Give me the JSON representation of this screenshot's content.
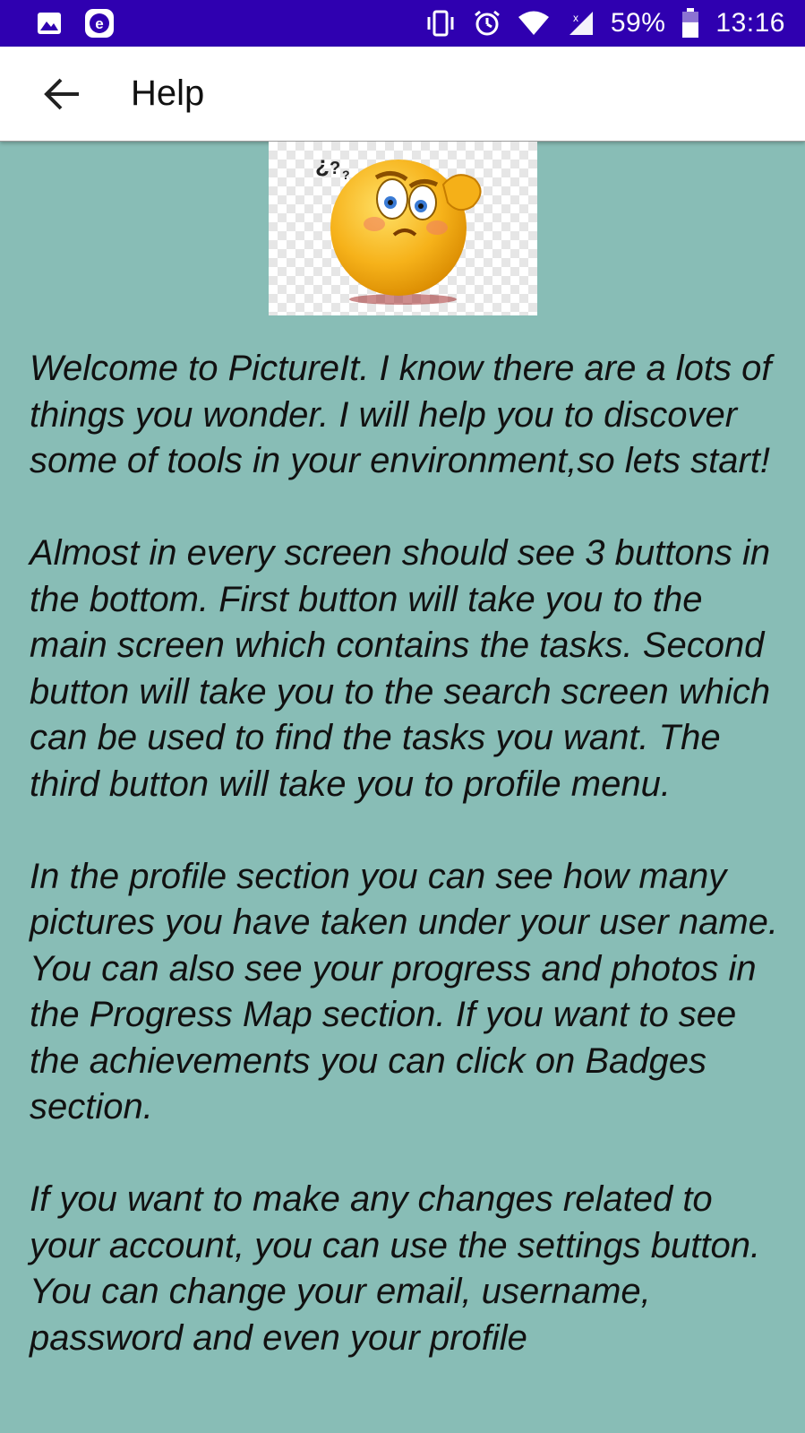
{
  "status_bar": {
    "battery_percent": "59%",
    "time": "13:16",
    "left_icons": [
      "image-icon",
      "e-badge-icon"
    ],
    "right_icons": [
      "vibrate-icon",
      "alarm-icon",
      "wifi-icon",
      "signal-icon",
      "battery-icon"
    ],
    "battery_level": 0.59
  },
  "app_bar": {
    "title": "Help",
    "back_icon": "arrow-back-icon"
  },
  "content": {
    "image_icon": "confused-emoji-icon",
    "paragraphs": [
      "Welcome to PictureIt. I know there are a lots of things you wonder. I will help you to discover some of tools in your environment,so lets start!",
      "Almost in every screen should see 3 buttons in the bottom. First button will take you to the main screen which contains the tasks. Second button will take you to the search screen which can be used to find the tasks you want. The third button will take you to profile menu.",
      "In the profile section you can see how many pictures you have taken under your user name. You can also see your progress and photos in the Progress Map section. If you want to see the achievements you can click on Badges section.",
      "If you want to make any changes related to your account, you can use the settings button. You can change your email, username, password and even your profile"
    ]
  },
  "colors": {
    "status_bar": "#2f00b0",
    "background": "#88bdb6",
    "app_bar": "#ffffff",
    "text": "#111111"
  }
}
